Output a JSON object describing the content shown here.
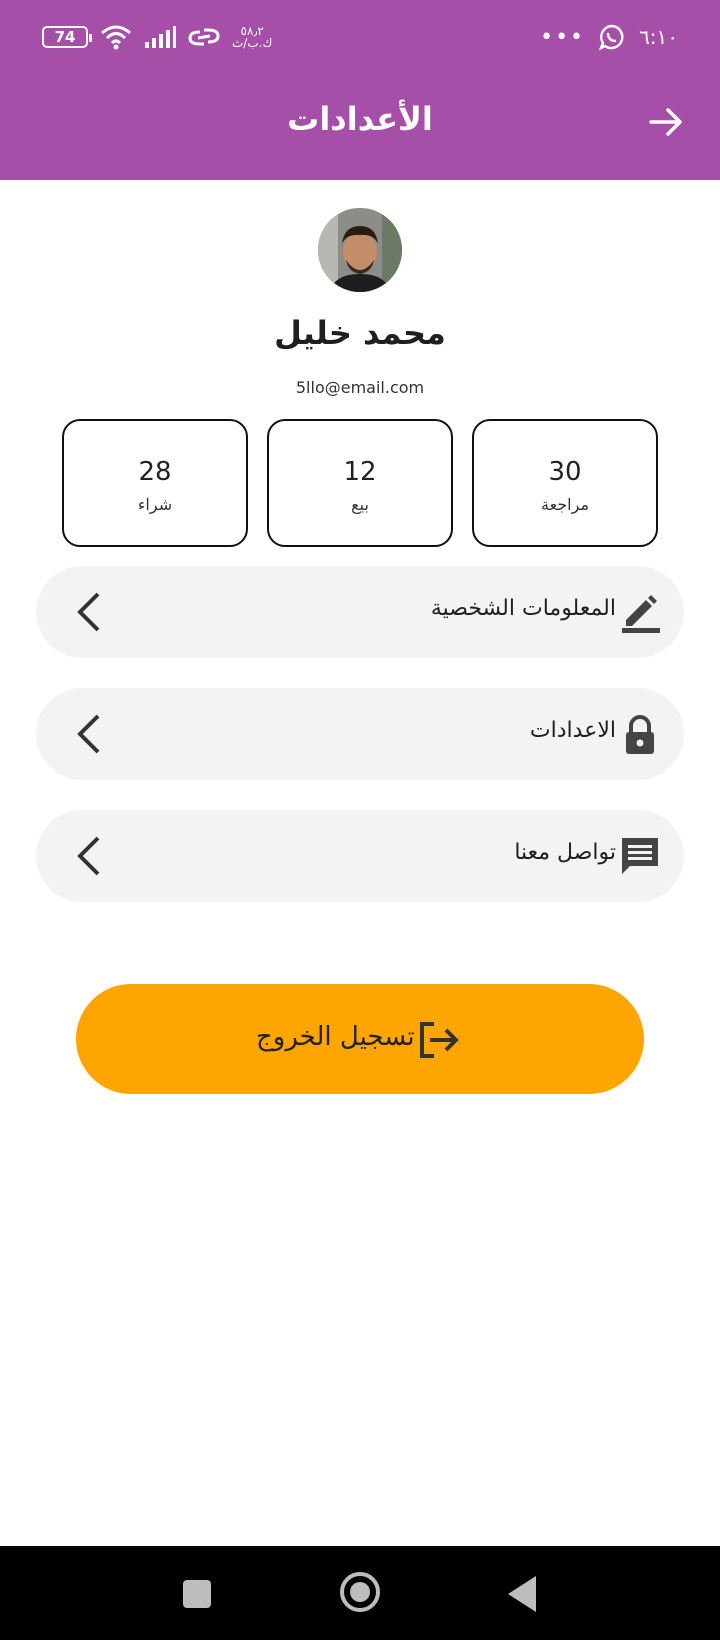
{
  "status_bar": {
    "battery": "74",
    "net_speed_line1": "٥٨٫٢",
    "net_speed_line2": "ك.ب/ث",
    "time": "٦:١٠",
    "more": "•••"
  },
  "header": {
    "title": "الأعدادات"
  },
  "profile": {
    "name": "محمد خليل",
    "email": "5llo@email.com"
  },
  "stats": [
    {
      "value": "28",
      "label": "شراء"
    },
    {
      "value": "12",
      "label": "بيع"
    },
    {
      "value": "30",
      "label": "مراجعة"
    }
  ],
  "menu": [
    {
      "label": "المعلومات الشخصية",
      "icon": "edit-icon"
    },
    {
      "label": "الاعدادات",
      "icon": "lock-icon"
    },
    {
      "label": "تواصل معنا",
      "icon": "chat-icon"
    }
  ],
  "logout": {
    "label": "تسجيل الخروج",
    "icon": "logout-icon"
  },
  "colors": {
    "header": "#a64fa8",
    "logout": "#ffa500",
    "row_bg": "#f3f3f6"
  }
}
